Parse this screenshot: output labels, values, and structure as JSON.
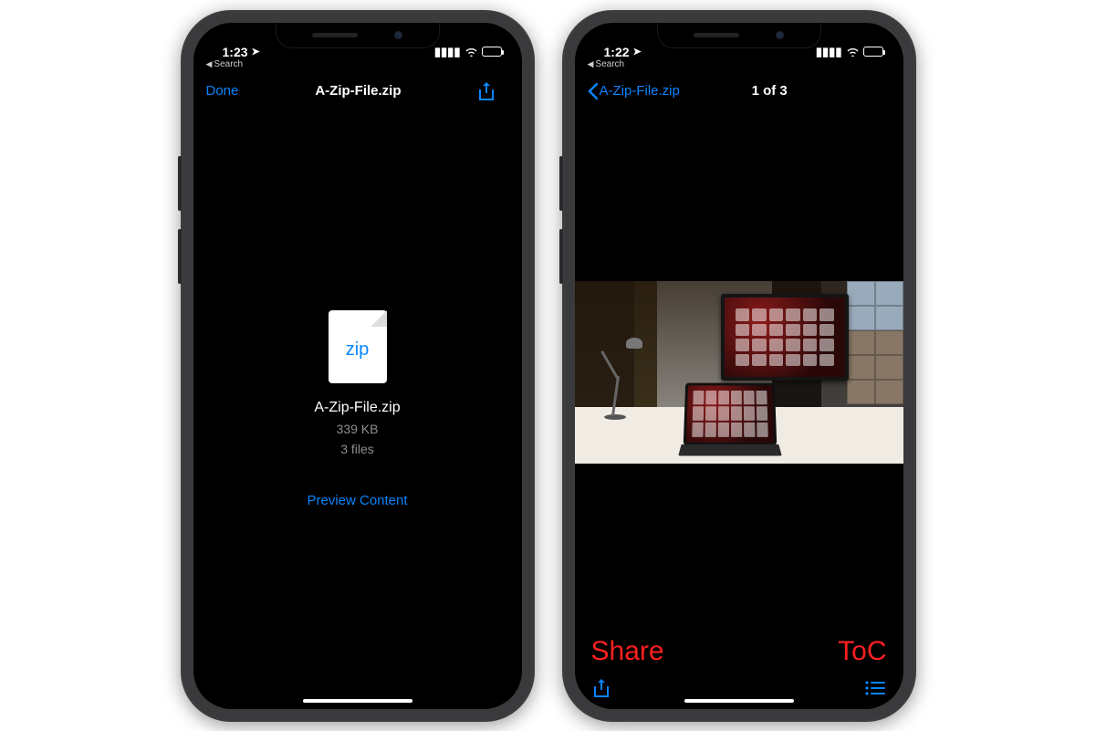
{
  "left_phone": {
    "status": {
      "time": "1:23",
      "location_indicator": "◀"
    },
    "breadcrumb": {
      "label": "Search"
    },
    "navbar": {
      "done": "Done",
      "title": "A-Zip-File.zip"
    },
    "file": {
      "icon_label": "zip",
      "name": "A-Zip-File.zip",
      "size": "339 KB",
      "count": "3 files"
    },
    "preview_link": "Preview Content"
  },
  "right_phone": {
    "status": {
      "time": "1:22",
      "location_indicator": "◀"
    },
    "breadcrumb": {
      "label": "Search"
    },
    "navbar": {
      "back_label": "A-Zip-File.zip",
      "title": "1 of 3"
    },
    "annotations": {
      "share": "Share",
      "toc": "ToC"
    }
  },
  "colors": {
    "tint": "#0a84ff",
    "annotation": "#ff2020"
  }
}
